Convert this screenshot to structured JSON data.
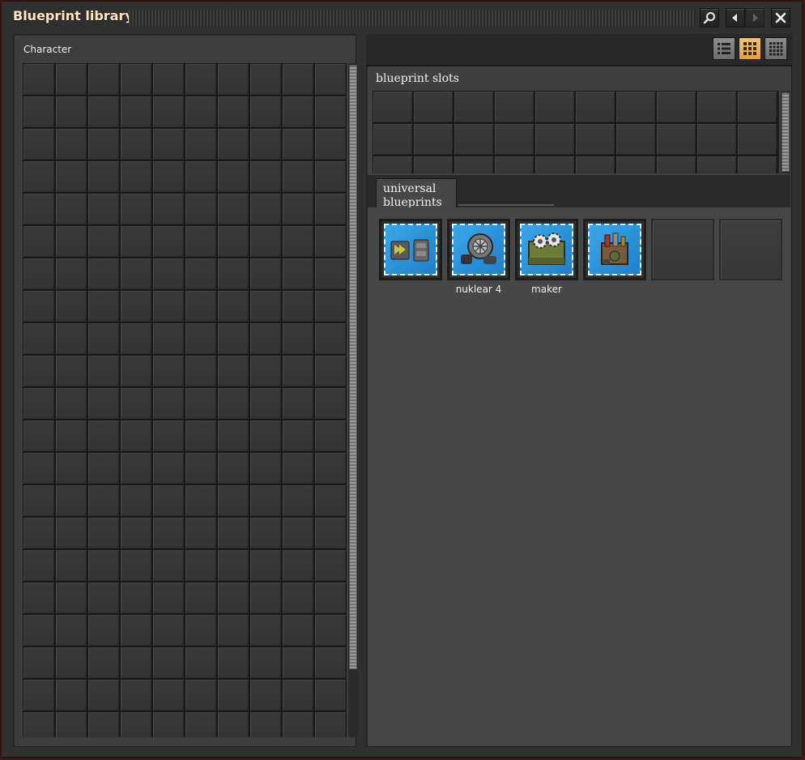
{
  "window": {
    "title": "Blueprint library"
  },
  "colors": {
    "accent": "#f2b85a",
    "blueprint_blue": "#2a93d9",
    "panel": "#3d3d3d",
    "title_text": "#ffe6c0"
  },
  "titlebar_buttons": [
    {
      "name": "search-button",
      "icon": "magnifier-icon"
    },
    {
      "name": "back-button",
      "icon": "arrow-left-icon"
    },
    {
      "name": "forward-button",
      "icon": "arrow-right-icon"
    },
    {
      "name": "close-button",
      "icon": "close-icon"
    }
  ],
  "left_panel": {
    "title": "Character",
    "grid": {
      "columns": 10,
      "visible_rows": 21
    }
  },
  "right_panel": {
    "view_modes": [
      {
        "name": "list-view",
        "icon": "list-icon",
        "active": false
      },
      {
        "name": "grid-view",
        "icon": "grid-icon",
        "active": true
      },
      {
        "name": "small-grid-view",
        "icon": "small-grid-icon",
        "active": false
      }
    ],
    "slots": {
      "title": "blueprint slots",
      "grid": {
        "columns": 10,
        "visible_rows": 3
      }
    },
    "tabs": [
      {
        "label": "universal blueprints",
        "active": true
      }
    ],
    "blueprints": [
      {
        "label": "",
        "icon": "belt-splitter-icon"
      },
      {
        "label": "nuklear 4",
        "icon": "reactor-turbine-icon"
      },
      {
        "label": "maker",
        "icon": "assembler-gears-icon"
      },
      {
        "label": "",
        "icon": "refinery-icon"
      },
      {
        "label": "",
        "icon": "empty"
      },
      {
        "label": "",
        "icon": "empty"
      }
    ]
  }
}
